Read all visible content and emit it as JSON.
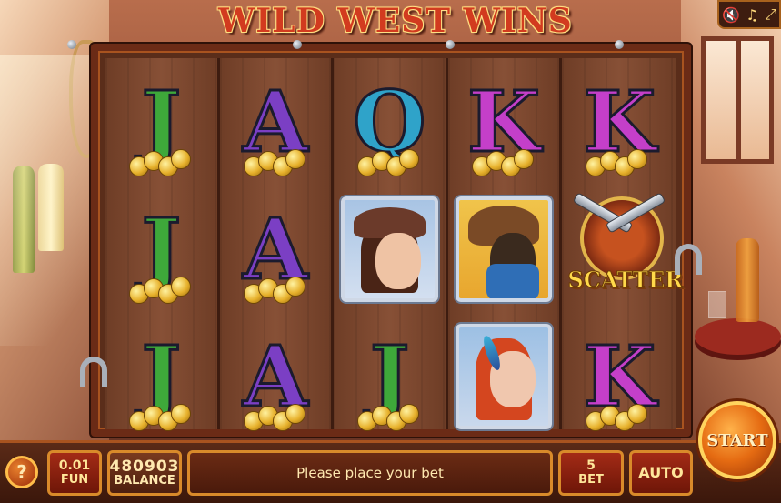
{
  "game": {
    "title": "WILD WEST WINS"
  },
  "sound_controls": {
    "mute_icon": "speaker-mute-icon",
    "music_icon": "music-note-icon",
    "fullscreen_icon": "fullscreen-icon",
    "mute_glyph": "🔇",
    "music_glyph": "♫",
    "fullscreen_glyph": "⤢"
  },
  "reels": [
    [
      "J",
      "J",
      "J"
    ],
    [
      "A",
      "A",
      "A"
    ],
    [
      "Q",
      "cowgirl",
      "J"
    ],
    [
      "K",
      "bandit",
      "redhead"
    ],
    [
      "K",
      "scatter",
      "K"
    ]
  ],
  "scatter": {
    "label": "SCATTER"
  },
  "controls": {
    "help_label": "?",
    "coin_value": "0.01",
    "coin_label": "FUN",
    "balance_value": "480903",
    "balance_label": "BALANCE",
    "message": "Please place your bet",
    "bet_value": "5",
    "bet_label": "BET",
    "auto_label": "AUTO",
    "start_label": "START"
  },
  "colors": {
    "letter_J": "#3ea83a",
    "letter_A": "#7b3fc4",
    "letter_Q": "#2fa3c9",
    "letter_K": "#c43fc9",
    "accent_gold": "#d98a2a",
    "button_red": "#a32b16"
  }
}
